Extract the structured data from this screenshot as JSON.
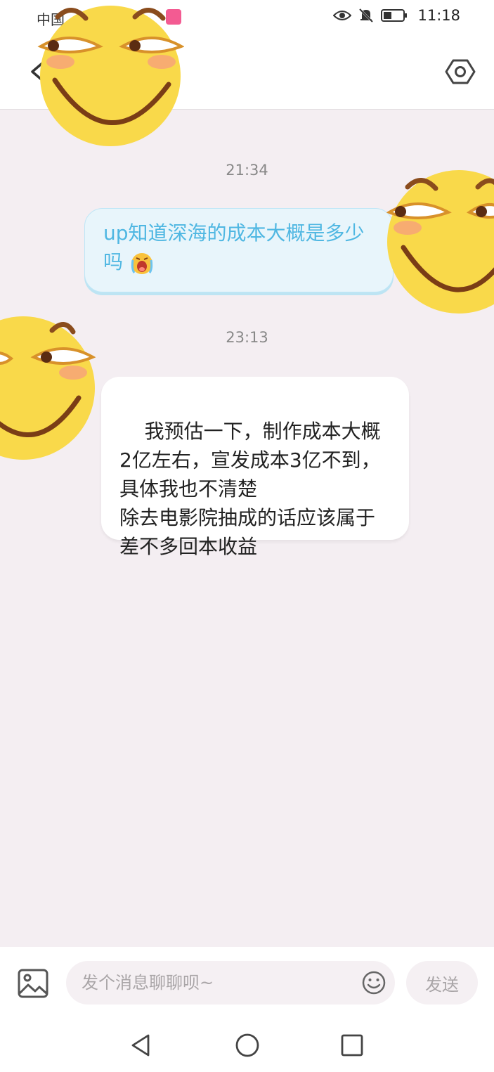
{
  "status_bar": {
    "carrier": "中国",
    "time": "11:18"
  },
  "header": {
    "back_icon": "back-arrow-icon",
    "settings_icon": "settings-hexagon-icon"
  },
  "messages": [
    {
      "time": "21:34",
      "direction": "outgoing",
      "text": "up知道深海的成本大概是多少吗",
      "emoji": "crying-face-emoji"
    },
    {
      "time": "23:13",
      "direction": "incoming",
      "text": "我预估一下，制作成本大概2亿左右，宣发成本3亿不到，具体我也不清楚\n除去电影院抽成的话应该属于差不多回本收益"
    }
  ],
  "input_bar": {
    "placeholder": "发个消息聊聊呗~",
    "send_label": "发送"
  },
  "colors": {
    "chat_background": "#f4eef2",
    "outgoing_bubble": "#e8f5fb",
    "outgoing_text": "#4fb7e2",
    "incoming_bubble": "#ffffff",
    "sticker_yellow": "#f9d94a"
  }
}
